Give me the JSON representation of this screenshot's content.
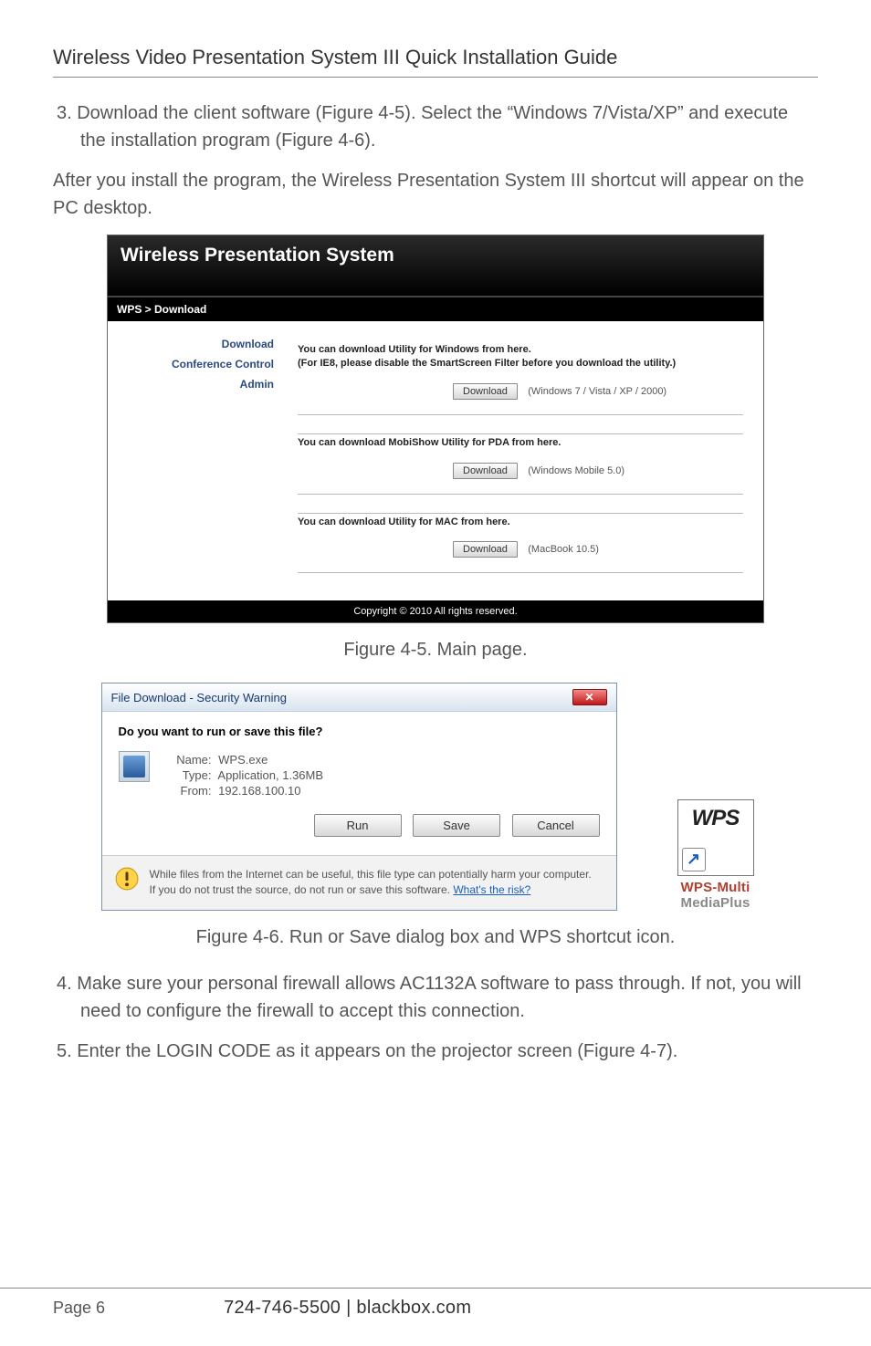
{
  "header": {
    "title": "Wireless Video Presentation System III Quick Installation Guide"
  },
  "paragraphs": {
    "step3": "3. Download the client software (Figure 4-5). Select the “Windows 7/Vista/XP” and execute the installation program (Figure 4-6).",
    "after": "After you install the program, the Wireless Presentation System III shortcut will appear on the PC desktop.",
    "fig45": "Figure 4-5. Main page.",
    "fig46": "Figure 4-6. Run or Save dialog box and WPS shortcut icon.",
    "step4": "4. Make sure your personal firewall allows AC1132A software to pass through. If not, you will need to configure the firewall to accept this connection.",
    "step5": "5. Enter the LOGIN CODE as it appears on the projector screen (Figure 4-7)."
  },
  "wps": {
    "title": "Wireless Presentation System",
    "breadcrumb": "WPS > Download",
    "side": {
      "items": [
        {
          "label": "Download",
          "active": true
        },
        {
          "label": "Conference Control",
          "active": true
        },
        {
          "label": "Admin",
          "active": true
        }
      ]
    },
    "sections": [
      {
        "text": "You can download Utility for Windows from here.\n(For IE8, please disable the SmartScreen Filter before you download the utility.)",
        "button": "Download",
        "label": "(Windows 7 / Vista / XP / 2000)"
      },
      {
        "text": "You can download MobiShow Utility for PDA from here.",
        "button": "Download",
        "label": "(Windows Mobile 5.0)"
      },
      {
        "text": "You can download Utility for MAC from here.",
        "button": "Download",
        "label": "(MacBook 10.5)"
      }
    ],
    "footer": "Copyright © 2010 All rights reserved."
  },
  "dialog": {
    "title": "File Download - Security Warning",
    "question": "Do you want to run or save this file?",
    "name_label": "Name:",
    "name_value": "WPS.exe",
    "type_label": "Type:",
    "type_value": "Application, 1.36MB",
    "from_label": "From:",
    "from_value": "192.168.100.10",
    "buttons": {
      "run": "Run",
      "save": "Save",
      "cancel": "Cancel"
    },
    "warn": "While files from the Internet can be useful, this file type can potentially harm your computer. If you do not trust the source, do not run or save this software. ",
    "risk": "What's the risk?"
  },
  "shortcut": {
    "wps": "WPS",
    "line1": "WPS-Multi",
    "line2": "MediaPlus"
  },
  "footer": {
    "page": "Page 6",
    "contact": "724-746-5500   |   blackbox.com"
  }
}
